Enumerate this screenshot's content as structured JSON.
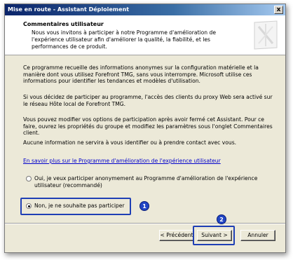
{
  "window": {
    "title": "Mise en route - Assistant Déploiement",
    "close_glyph": "x"
  },
  "header": {
    "title": "Commentaires utilisateur",
    "subtitle": "Nous vous invitons à participer à notre Programme d'amélioration de l'expérience utilisateur afin d'améliorer la qualité, la fiabilité, et les performances de ce produit."
  },
  "body": {
    "para1": "Ce programme recueille des informations anonymes sur la configuration matérielle et la manière dont vous utilisez Forefront TMG, sans vous interrompre. Microsoft utilise ces informations pour identifier les tendances et modèles d'utilisation.",
    "para2": "Si vous décidez de participer au programme, l'accès des clients du proxy Web sera activé sur le réseau Hôte local de Forefront TMG.",
    "para3": "Vous pouvez modifier vos options de participation après avoir fermé cet Assistant. Pour ce faire, ouvrez les propriétés du groupe et modifiez les paramètres sous l'onglet Commentaires client.",
    "para4": "Aucune information ne servira à vous identifier ou à prendre contact avec vous.",
    "link": "En savoir plus sur le Programme d'amélioration de l'expérience utilisateur"
  },
  "options": {
    "yes_label": "Oui, je veux participer anonymement au Programme d'amélioration de l'expérience utilisateur (recommandé)",
    "no_label": "Non, je ne souhaite pas participer",
    "selected": "no"
  },
  "annotations": {
    "badge1": "1",
    "badge2": "2",
    "color": "#2145c4"
  },
  "buttons": {
    "back": "< Précédent",
    "next": "Suivant >",
    "cancel": "Annuler"
  }
}
